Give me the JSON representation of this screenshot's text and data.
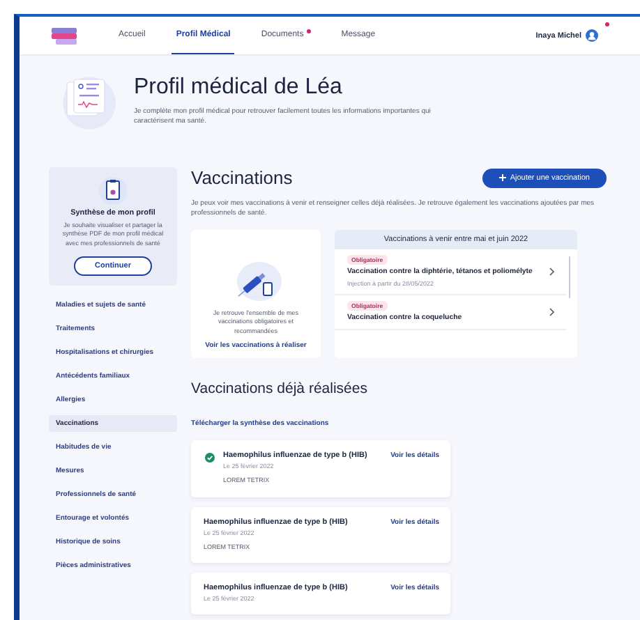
{
  "nav": {
    "tabs": [
      {
        "label": "Accueil",
        "selected": false,
        "notify": false
      },
      {
        "label": "Profil Médical",
        "selected": true,
        "notify": false
      },
      {
        "label": "Documents",
        "selected": false,
        "notify": true
      },
      {
        "label": "Message",
        "selected": false,
        "notify": false
      }
    ],
    "user": {
      "name": "Inaya Michel",
      "notify": true
    }
  },
  "hero": {
    "title": "Profil médical de Léa",
    "description": "Je complète mon profil médical pour retrouver facilement toutes les informations importantes qui caractérisent ma santé."
  },
  "sidebar": {
    "summary": {
      "title": "Synthèse de mon profil",
      "description": "Je souhaite visualiser et partager la synthèse PDF de mon profil médical avec mes professionnels de santé",
      "button": "Continuer"
    },
    "items": [
      {
        "label": "Maladies et sujets de santé",
        "selected": false
      },
      {
        "label": "Traitements",
        "selected": false
      },
      {
        "label": "Hospitalisations et chirurgies",
        "selected": false
      },
      {
        "label": "Antécédents familiaux",
        "selected": false
      },
      {
        "label": "Allergies",
        "selected": false
      },
      {
        "label": "Vaccinations",
        "selected": true
      },
      {
        "label": "Habitudes de vie",
        "selected": false
      },
      {
        "label": "Mesures",
        "selected": false
      },
      {
        "label": "Professionnels de santé",
        "selected": false
      },
      {
        "label": "Entourage et volontés",
        "selected": false
      },
      {
        "label": "Historique de soins",
        "selected": false
      },
      {
        "label": "Pièces administratives",
        "selected": false
      }
    ]
  },
  "main": {
    "title": "Vaccinations",
    "add_button": "Ajouter une vaccination",
    "description": "Je peux voir mes vaccinations à venir et renseigner celles déjà réalisées. Je retrouve également les vaccinations ajoutées par mes professionnels de santé.",
    "promo": {
      "text": "Je retrouve l'ensemble de mes vaccinations obligatoires et recommandées",
      "link": "Voir les vaccinations à réaliser"
    },
    "upcoming": {
      "title": "Vaccinations à venir entre mai et juin 2022",
      "items": [
        {
          "tag": "Obligatoire",
          "name": "Vaccination contre la diphtérie, tétanos et poliomélyte",
          "date": "Injection à partir du 28/05/2022"
        },
        {
          "tag": "Obligatoire",
          "name": "Vaccination contre la coqueluche"
        }
      ]
    },
    "done": {
      "title": "Vaccinations déjà réalisées",
      "download_link": "Télécharger la synthèse des vaccinations",
      "items": [
        {
          "name": "Haemophilus influenzae de type b (HIB)",
          "date": "Le 25 février 2022",
          "by": "LOREM TETRIX",
          "verified": true,
          "link": "Voir les détails"
        },
        {
          "name": "Haemophilus influenzae de type b (HIB)",
          "date": "Le 25 février 2022",
          "by": "LOREM TETRIX",
          "verified": false,
          "link": "Voir les détails"
        },
        {
          "name": "Haemophilus influenzae de type b (HIB)",
          "date": "Le 25 février 2022",
          "verified": false,
          "link": "Voir les détails"
        }
      ]
    }
  }
}
